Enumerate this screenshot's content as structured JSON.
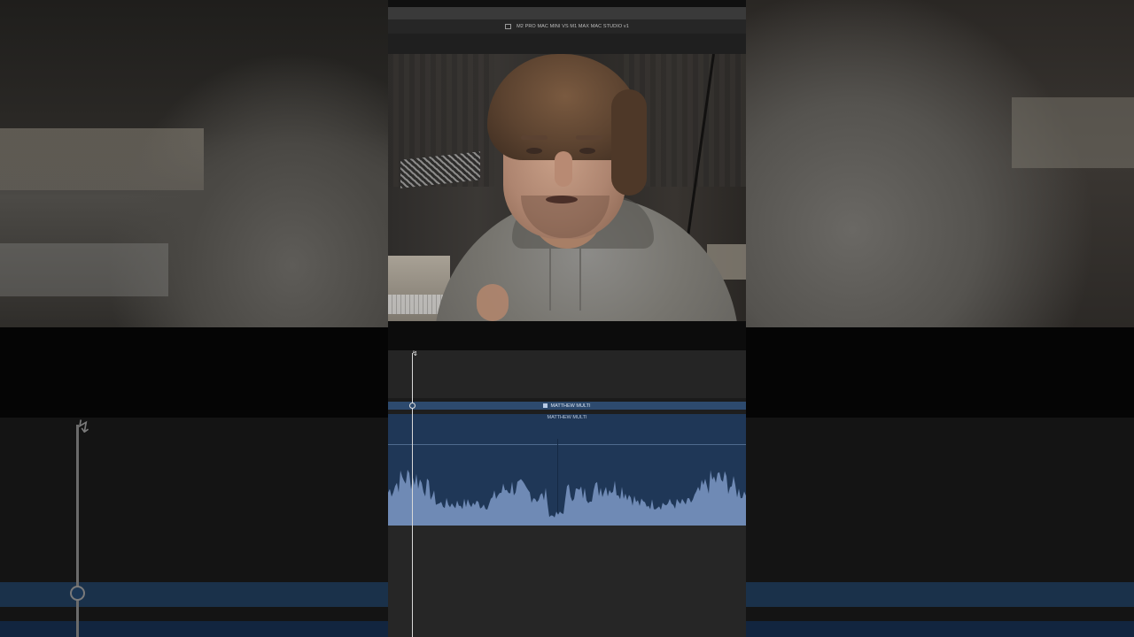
{
  "viewer": {
    "project_title": "M2 PRO MAC MINI VS M1 MAX MAC STUDIO v1"
  },
  "timeline": {
    "primary_clip_label": "MATTHEW MULTI",
    "audio_clip_label": "MATTHEW MULTI"
  },
  "icons": {
    "project": "film-doc-icon",
    "clip": "multicam-clip-icon",
    "cursor": "trim-cursor-icon"
  },
  "colors": {
    "clip_blue": "#2d4a6e",
    "audio_blue": "#1f3757",
    "waveform": "#6f8ab5",
    "timeline_bg": "#252525"
  }
}
